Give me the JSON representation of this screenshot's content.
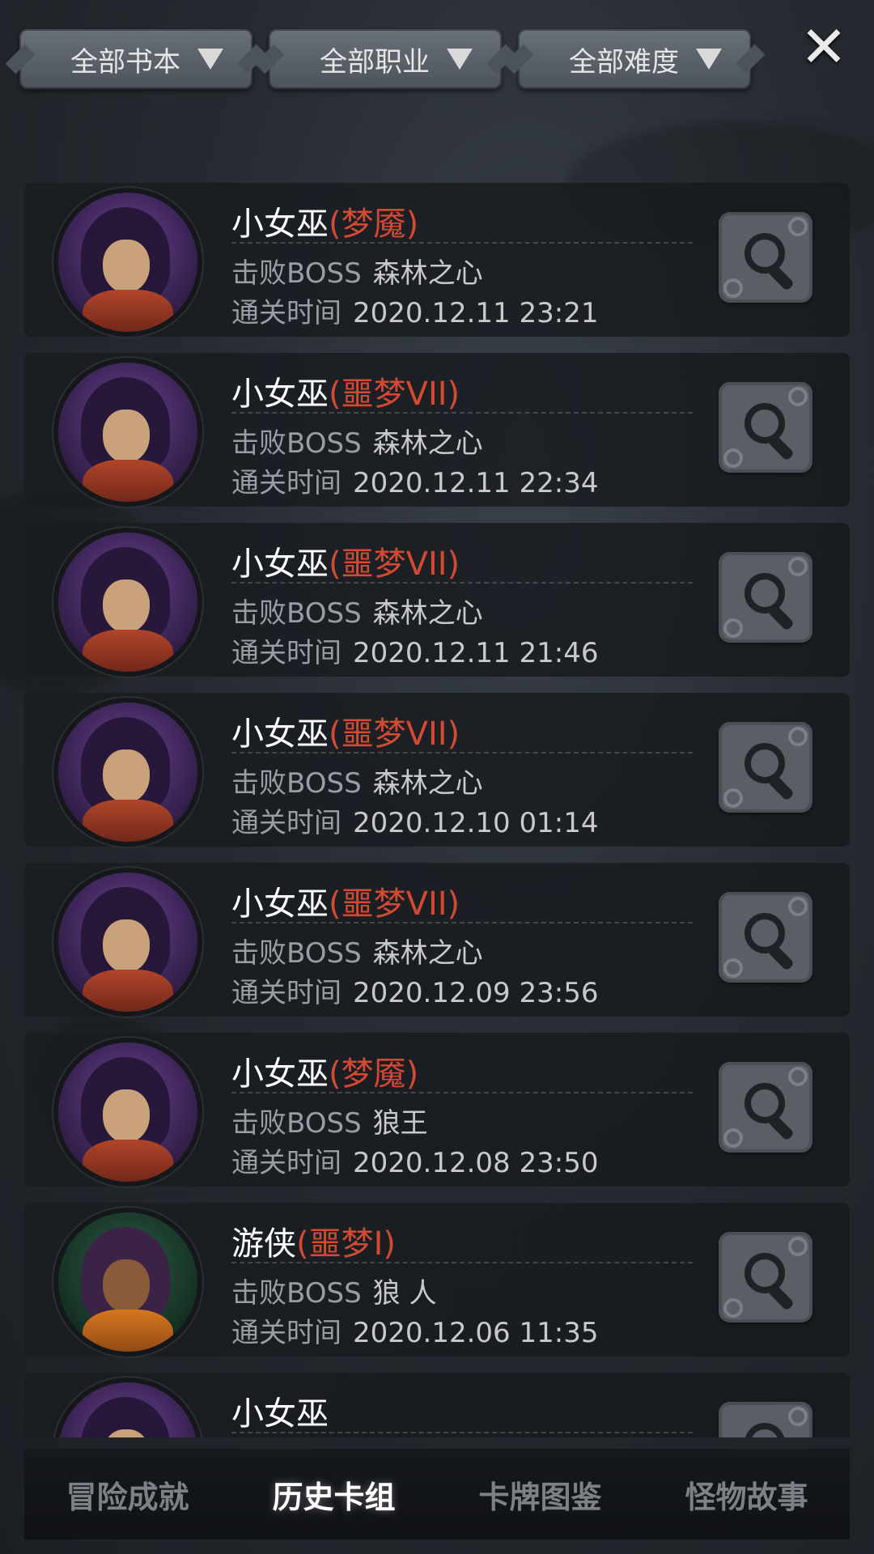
{
  "filters": [
    {
      "label": "全部书本"
    },
    {
      "label": "全部职业"
    },
    {
      "label": "全部难度"
    }
  ],
  "close_icon": "close-icon",
  "records": [
    {
      "char": "小女巫",
      "difficulty": "(梦魇)",
      "boss_label": "击败BOSS",
      "boss": "森林之心",
      "time_label": "通关时间",
      "time": "2020.12.11 23:21",
      "avatar": "witch"
    },
    {
      "char": "小女巫",
      "difficulty": "(噩梦VII)",
      "boss_label": "击败BOSS",
      "boss": "森林之心",
      "time_label": "通关时间",
      "time": "2020.12.11 22:34",
      "avatar": "witch"
    },
    {
      "char": "小女巫",
      "difficulty": "(噩梦VII)",
      "boss_label": "击败BOSS",
      "boss": "森林之心",
      "time_label": "通关时间",
      "time": "2020.12.11 21:46",
      "avatar": "witch"
    },
    {
      "char": "小女巫",
      "difficulty": "(噩梦VII)",
      "boss_label": "击败BOSS",
      "boss": "森林之心",
      "time_label": "通关时间",
      "time": "2020.12.10 01:14",
      "avatar": "witch"
    },
    {
      "char": "小女巫",
      "difficulty": "(噩梦VII)",
      "boss_label": "击败BOSS",
      "boss": "森林之心",
      "time_label": "通关时间",
      "time": "2020.12.09 23:56",
      "avatar": "witch"
    },
    {
      "char": "小女巫",
      "difficulty": "(梦魇)",
      "boss_label": "击败BOSS",
      "boss": "狼王",
      "time_label": "通关时间",
      "time": "2020.12.08 23:50",
      "avatar": "witch"
    },
    {
      "char": "游侠",
      "difficulty": "(噩梦I)",
      "boss_label": "击败BOSS",
      "boss": "狼 人",
      "time_label": "通关时间",
      "time": "2020.12.06 11:35",
      "avatar": "ranger"
    },
    {
      "char": "小女巫",
      "difficulty": "",
      "boss_label": "",
      "boss": "",
      "time_label": "",
      "time": "",
      "avatar": "witch"
    }
  ],
  "tabs": [
    {
      "label": "冒险成就",
      "active": false
    },
    {
      "label": "历史卡组",
      "active": true
    },
    {
      "label": "卡牌图鉴",
      "active": false
    },
    {
      "label": "怪物故事",
      "active": false
    }
  ],
  "colors": {
    "difficulty": "#d34a33",
    "active_tab": "#ffffff",
    "inactive_tab": "#7d8187"
  }
}
